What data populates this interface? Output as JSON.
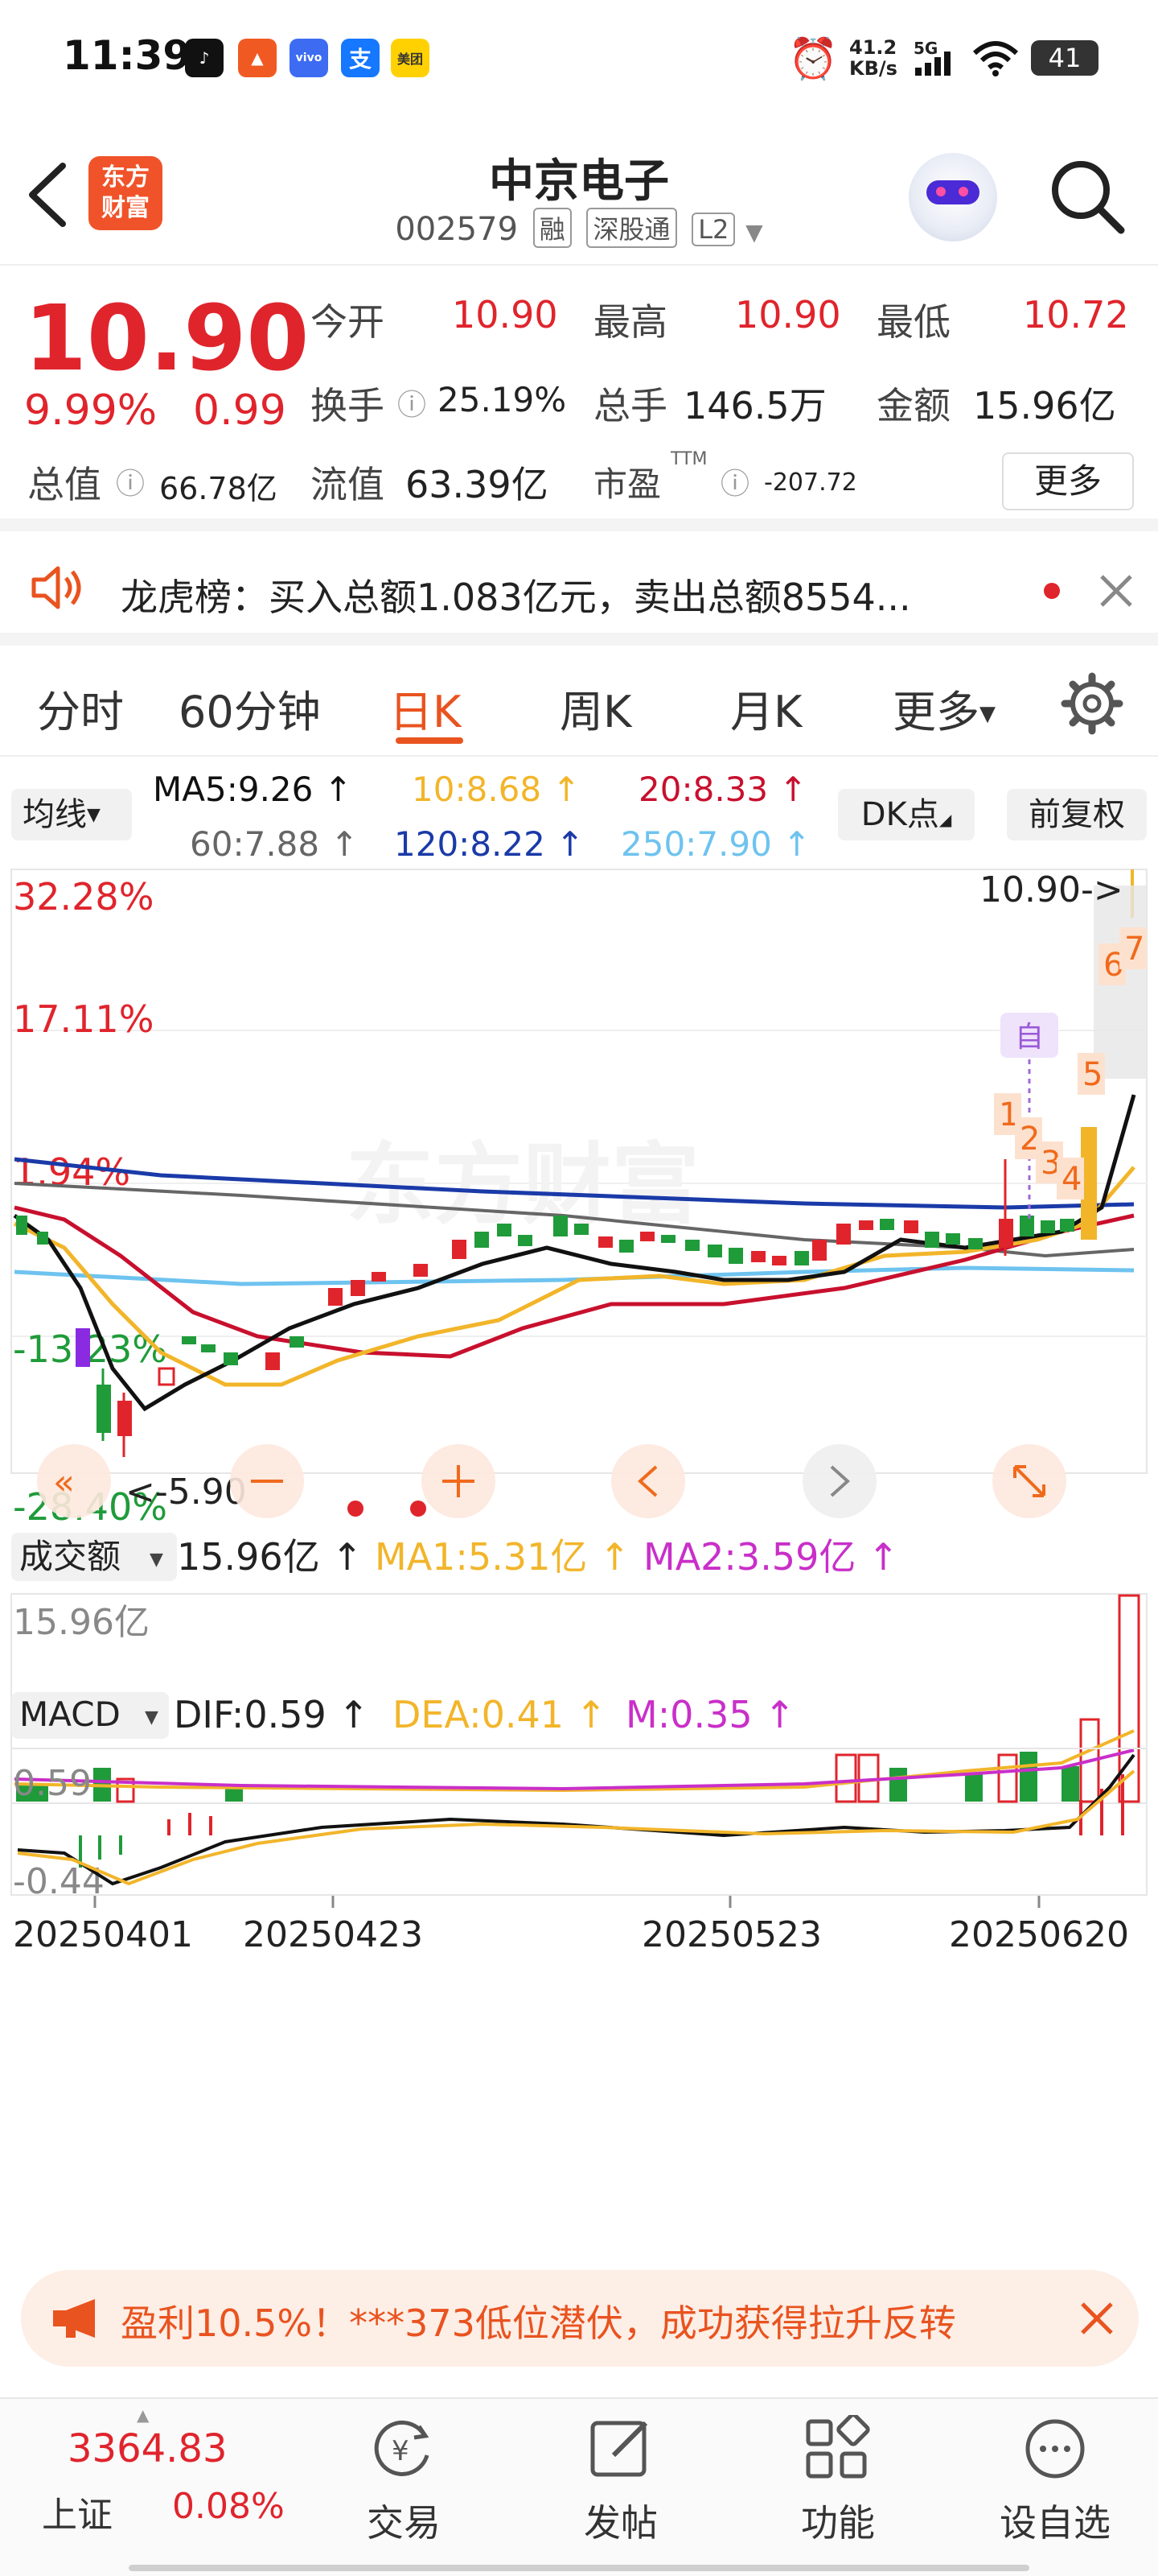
{
  "status_bar": {
    "time": "11:39",
    "net_speed_value": "41.2",
    "net_speed_unit": "KB/s",
    "network": "5G",
    "battery": "41",
    "apps": [
      "tiktok-icon",
      "app-orange-icon",
      "vivo-icon",
      "alipay-icon",
      "meituan-icon"
    ]
  },
  "header": {
    "logo_line1": "东方",
    "logo_line2": "财富",
    "title": "中京电子",
    "code": "002579",
    "tags": [
      "融",
      "深股通",
      "L2"
    ]
  },
  "quote": {
    "price": "10.90",
    "change_pct": "9.99%",
    "change": "0.99",
    "open_label": "今开",
    "open": "10.90",
    "high_label": "最高",
    "high": "10.90",
    "low_label": "最低",
    "low": "10.72",
    "turnover_label": "换手",
    "turnover": "25.19%",
    "volume_label": "总手",
    "volume": "146.5万",
    "amount_label": "金额",
    "amount": "15.96亿",
    "mktcap_label": "总值",
    "mktcap": "66.78亿",
    "float_label": "流值",
    "float": "63.39亿",
    "pe_label": "市盈",
    "pe_sup": "TTM",
    "pe": "-207.72",
    "more_button": "更多"
  },
  "notice": {
    "text": "龙虎榜：买入总额1.083亿元，卖出总额8554..."
  },
  "tabs": [
    {
      "label": "分时"
    },
    {
      "label": "60分钟"
    },
    {
      "label": "日K"
    },
    {
      "label": "周K"
    },
    {
      "label": "月K"
    },
    {
      "label": "更多"
    }
  ],
  "ma": {
    "selector": "均线",
    "ma5": "MA5:9.26 ↑",
    "ma10": "10:8.68 ↑",
    "ma20": "20:8.33 ↑",
    "ma60": "60:7.88 ↑",
    "ma120": "120:8.22 ↑",
    "ma250": "250:7.90 ↑",
    "dk_button": "DK点",
    "adjust_button": "前复权"
  },
  "colors": {
    "up": "#e0242c",
    "down": "#1f9b3a",
    "ma5": "#111111",
    "ma10": "#f2b52a",
    "ma20": "#c8102e",
    "ma60": "#666666",
    "ma120": "#1a3aa8",
    "ma250": "#6ec3ef",
    "accent": "#e9531f",
    "purple": "#8a2be2"
  },
  "kchart": {
    "y_labels": [
      "32.28%",
      "17.11%",
      "1.94%",
      "-13.23%",
      "-28.40%"
    ],
    "last_price_tag": "10.90->",
    "low_tag": "<-5.90",
    "signal_labels": [
      "1",
      "2",
      "3",
      "4",
      "5",
      "6",
      "7"
    ],
    "self_select_badge": "自",
    "watermark": "东方财富",
    "controls": [
      "double-left-icon",
      "zoom-out-icon",
      "zoom-in-icon",
      "left-arrow-icon",
      "right-arrow-icon",
      "expand-icon"
    ]
  },
  "chart_data": [
    {
      "type": "candlestick",
      "title": "",
      "x_labels": [
        "20250401",
        "20250423",
        "20250523",
        "20250620"
      ],
      "y_labels": [
        "32.28%",
        "17.11%",
        "1.94%",
        "-13.23%",
        "-28.40%"
      ],
      "last": 10.9,
      "low": 5.9,
      "series": [
        {
          "name": "MA5",
          "value": 9.26
        },
        {
          "name": "MA10",
          "value": 8.68
        },
        {
          "name": "MA20",
          "value": 8.33
        },
        {
          "name": "MA60",
          "value": 7.88
        },
        {
          "name": "MA120",
          "value": 8.22
        },
        {
          "name": "MA250",
          "value": 7.9
        }
      ]
    },
    {
      "type": "bar",
      "title": "成交额",
      "y_max_label": "15.96亿",
      "series": [
        {
          "name": "成交额",
          "value": "15.96亿"
        },
        {
          "name": "MA1",
          "value": "5.31亿"
        },
        {
          "name": "MA2",
          "value": "3.59亿"
        }
      ]
    },
    {
      "type": "line",
      "title": "MACD",
      "y_labels": [
        "0.59",
        "-0.44"
      ],
      "series": [
        {
          "name": "DIF",
          "value": 0.59
        },
        {
          "name": "DEA",
          "value": 0.41
        },
        {
          "name": "M",
          "value": 0.35
        }
      ]
    }
  ],
  "volume": {
    "selector": "成交额",
    "value": "15.96亿 ↑",
    "ma1": "MA1:5.31亿 ↑",
    "ma2": "MA2:3.59亿 ↑",
    "max_label": "15.96亿"
  },
  "macd": {
    "selector": "MACD",
    "dif": "DIF:0.59 ↑",
    "dea": "DEA:0.41 ↑",
    "m": "M:0.35 ↑",
    "top_label": "0.59",
    "bottom_label": "-0.44"
  },
  "x_axis": [
    "20250401",
    "20250423",
    "20250523",
    "20250620"
  ],
  "promo": {
    "text": "盈利10.5%！***373低位潜伏，成功获得拉升反转"
  },
  "bottom_nav": {
    "index_value": "3364.83",
    "index_name": "上证",
    "index_change": "0.08%",
    "items": [
      {
        "label": "交易",
        "icon": "trade-icon"
      },
      {
        "label": "发帖",
        "icon": "post-icon"
      },
      {
        "label": "功能",
        "icon": "grid-icon"
      },
      {
        "label": "设自选",
        "icon": "more-dots-icon"
      }
    ]
  }
}
